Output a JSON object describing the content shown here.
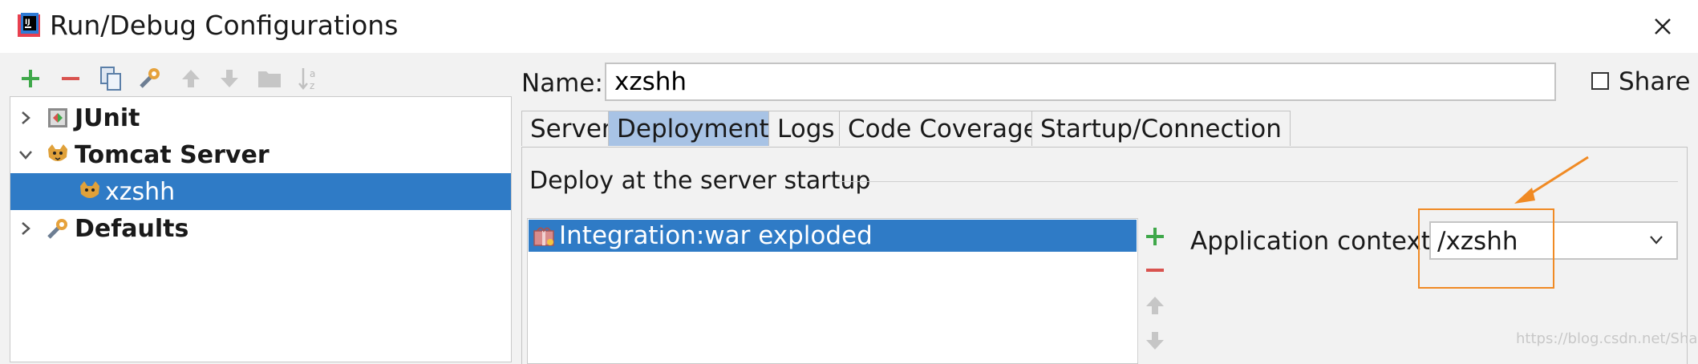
{
  "window": {
    "title": "Run/Debug Configurations"
  },
  "tree": {
    "items": [
      {
        "label": "JUnit",
        "icon": "junit-icon"
      },
      {
        "label": "Tomcat Server",
        "icon": "tomcat-icon"
      },
      {
        "label": "xzshh",
        "icon": "tomcat-config-icon"
      },
      {
        "label": "Defaults",
        "icon": "wrench-icon"
      }
    ]
  },
  "form": {
    "name_label": "Name:",
    "name_value": "xzshh",
    "share_label": "Share"
  },
  "tabs": [
    {
      "label": "Server"
    },
    {
      "label": "Deployment",
      "active": true
    },
    {
      "label": "Logs"
    },
    {
      "label": "Code Coverage"
    },
    {
      "label": "Startup/Connection"
    }
  ],
  "deployment": {
    "heading": "Deploy at the server startup",
    "artifacts": [
      "Integration:war exploded"
    ],
    "context_label": "Application context:",
    "context_value": "/xzshh"
  },
  "watermark": "https://blog.csdn.net/Sharylala",
  "colors": {
    "selection": "#2f7bc6",
    "active_tab": "#a8c3e5",
    "annotation": "#f08a24",
    "add_green": "#3fa84a",
    "remove_red": "#d9534f"
  }
}
